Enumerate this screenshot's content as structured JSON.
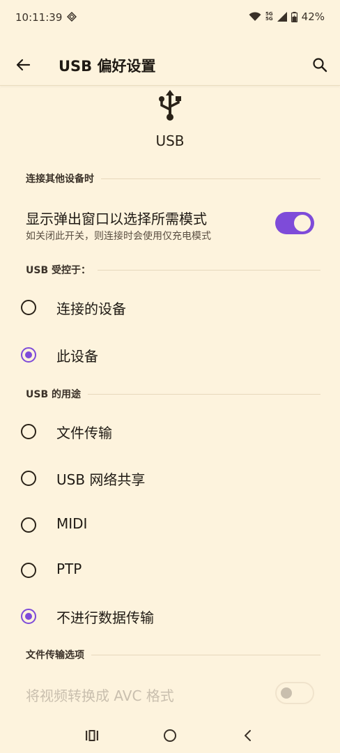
{
  "status_bar": {
    "time": "10:11:39",
    "network_top": "5G",
    "network_bottom": "5G",
    "battery": "42%"
  },
  "app_bar": {
    "title": "USB 偏好设置",
    "back_icon": "arrow-left-icon",
    "search_icon": "search-icon"
  },
  "hero": {
    "icon": "usb-icon",
    "label": "USB"
  },
  "sections": {
    "connect_other": {
      "header": "连接其他设备时",
      "toggle_title": "显示弹出窗口以选择所需模式",
      "toggle_subtitle": "如关闭此开关，则连接时会使用仅充电模式",
      "toggle_on": true
    },
    "controlled_by": {
      "header": "USB 受控于：",
      "options": [
        {
          "label": "连接的设备",
          "selected": false
        },
        {
          "label": "此设备",
          "selected": true
        }
      ]
    },
    "usb_use": {
      "header": "USB 的用途",
      "options": [
        {
          "label": "文件传输",
          "selected": false
        },
        {
          "label": "USB 网络共享",
          "selected": false
        },
        {
          "label": "MIDI",
          "selected": false
        },
        {
          "label": "PTP",
          "selected": false
        },
        {
          "label": "不进行数据传输",
          "selected": true
        }
      ]
    },
    "file_transfer_options": {
      "header": "文件传输选项",
      "toggle_title": "将视频转换成 AVC 格式",
      "toggle_on": false,
      "enabled": false
    }
  },
  "colors": {
    "background": "#FDF3DD",
    "accent": "#7E4BD9",
    "disabled": "#c9bfae"
  },
  "nav_bar": {
    "recents_icon": "recents-icon",
    "home_icon": "home-circle-icon",
    "back_icon": "chevron-left-icon"
  }
}
